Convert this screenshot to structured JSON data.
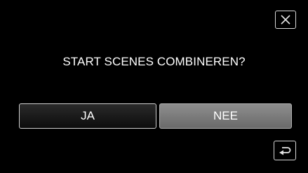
{
  "dialog": {
    "question": "START SCENES COMBINEREN?",
    "yes_label": "JA",
    "no_label": "NEE"
  },
  "icons": {
    "close": "close-icon",
    "back": "back-return-icon"
  },
  "colors": {
    "background": "#000000",
    "yes_button": "#1a1a1a",
    "no_button": "#7c7c7c",
    "text": "#ffffff"
  }
}
